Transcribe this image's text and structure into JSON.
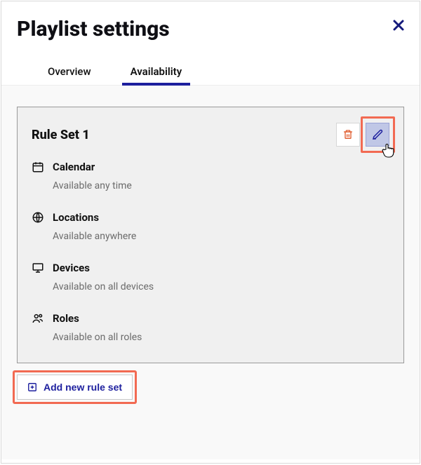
{
  "dialog": {
    "title": "Playlist settings"
  },
  "tabs": {
    "overview": "Overview",
    "availability": "Availability",
    "active": "availability"
  },
  "ruleset": {
    "title": "Rule Set 1",
    "sections": {
      "calendar": {
        "label": "Calendar",
        "value": "Available any time"
      },
      "locations": {
        "label": "Locations",
        "value": "Available anywhere"
      },
      "devices": {
        "label": "Devices",
        "value": "Available on all devices"
      },
      "roles": {
        "label": "Roles",
        "value": "Available on all roles"
      }
    }
  },
  "actions": {
    "add_new_rule_set": "Add new rule set"
  },
  "colors": {
    "accent": "#1d1f9e",
    "danger": "#e05a2b",
    "highlight": "#f26a52"
  }
}
